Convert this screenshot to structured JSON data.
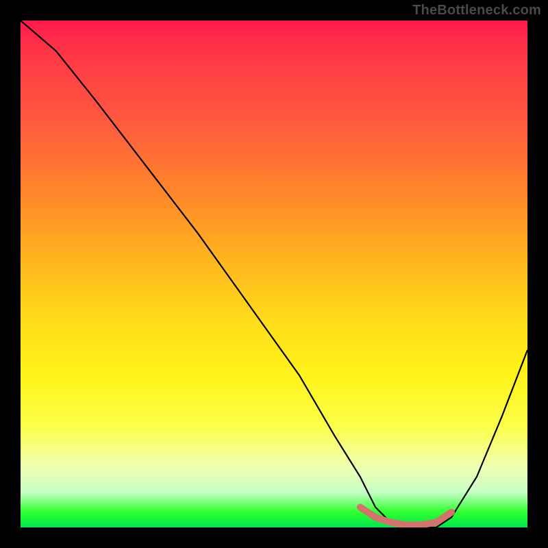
{
  "watermark": "TheBottleneck.com",
  "chart_data": {
    "type": "line",
    "title": "",
    "xlabel": "",
    "ylabel": "",
    "xlim": [
      0,
      100
    ],
    "ylim": [
      0,
      100
    ],
    "series": [
      {
        "name": "bottleneck-curve",
        "x": [
          0,
          7,
          15,
          25,
          35,
          45,
          55,
          62,
          67,
          70,
          73,
          78,
          82,
          85,
          90,
          95,
          100
        ],
        "values": [
          100,
          94,
          84,
          71,
          58,
          44,
          30,
          18,
          10,
          4,
          1,
          0,
          0,
          2,
          10,
          22,
          35
        ]
      }
    ],
    "marker": {
      "name": "highlight-range",
      "color": "#d4736e",
      "x": [
        67,
        70,
        73,
        76,
        79,
        82,
        85
      ],
      "values": [
        4,
        2,
        1,
        0.5,
        0.5,
        1,
        3
      ]
    },
    "gradient_stops": [
      {
        "pos": 0,
        "color": "#ff1a4d"
      },
      {
        "pos": 35,
        "color": "#ff8a2a"
      },
      {
        "pos": 70,
        "color": "#fff31a"
      },
      {
        "pos": 100,
        "color": "#00e64d"
      }
    ]
  }
}
